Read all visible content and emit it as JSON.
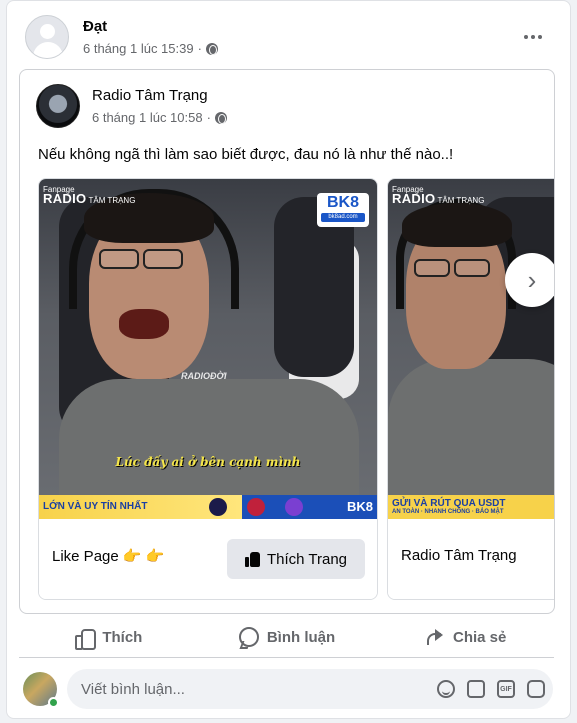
{
  "post": {
    "author": "Đạt",
    "time": "6 tháng 1 lúc 15:39",
    "separator": "·"
  },
  "shared": {
    "author": "Radio Tâm Trạng",
    "time": "6 tháng 1 lúc 10:58",
    "text": "Nếu không ngã thì làm sao biết được, đau nó là như thế nào..!"
  },
  "carousel": {
    "slides": [
      {
        "brand_small": "Fanpage",
        "brand_big": "RADIO",
        "brand_sub": "TÂM TRẠNG",
        "sponsor": "BK8",
        "sponsor_url": "bk8ad.com",
        "watermark": "RADIOĐỜI",
        "caption": "Lúc đấy ai ở bên cạnh mình",
        "ad_text": "LỚN VÀ UY TÍN NHẤT",
        "ad_logo": "BK8",
        "footer_label": "Like Page 👉 👉",
        "button_label": "Thích Trang"
      },
      {
        "brand_small": "Fanpage",
        "brand_big": "RADIO",
        "brand_sub": "TÂM TRẠNG",
        "ad_text": "GỬI VÀ RÚT QUA USDT",
        "ad_sub": "AN TOÀN · NHANH CHÓNG · BẢO MẬT",
        "footer_label": "Radio Tâm Trạng"
      }
    ],
    "next_icon": "chevron-right-icon"
  },
  "actions": {
    "like": "Thích",
    "comment": "Bình luận",
    "share": "Chia sẻ"
  },
  "comment": {
    "placeholder": "Viết bình luận...",
    "icons": [
      "emoji-icon",
      "camera-icon",
      "gif-icon",
      "sticker-icon"
    ],
    "gif_label": "GIF"
  },
  "colors": {
    "secondary_text": "#65676b",
    "online": "#31a24c",
    "caption": "#f5e64a"
  }
}
